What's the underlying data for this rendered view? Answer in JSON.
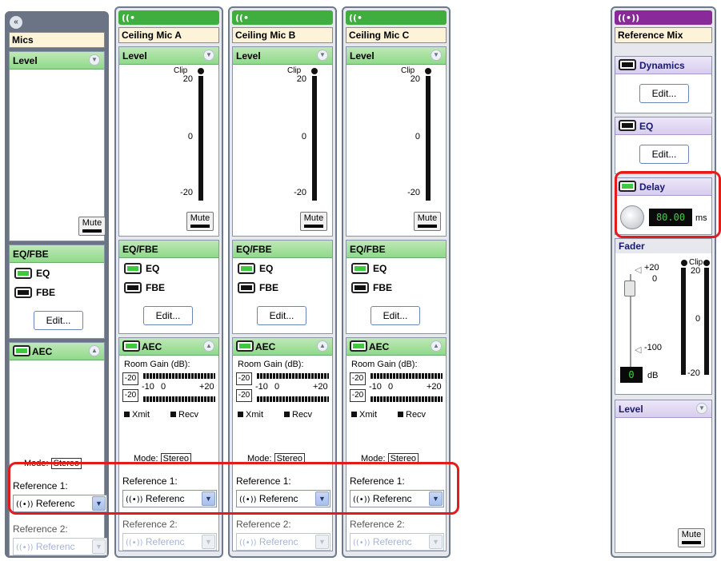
{
  "mics_strip": {
    "collapse_icon": "double-chevron-left-icon",
    "name": "Mics",
    "level_title": "Level",
    "mute_label": "Mute",
    "eqfbe_title": "EQ/FBE",
    "eq_label": "EQ",
    "fbe_label": "FBE",
    "edit_label": "Edit...",
    "aec_title": "AEC",
    "mode_label": "Mode:",
    "mode_value": "Stereo",
    "ref1_label": "Reference 1:",
    "ref1_value": "Referenc",
    "ref2_label": "Reference 2:",
    "ref2_value": "Referenc"
  },
  "channels": [
    {
      "name": "Ceiling Mic A",
      "level_title": "Level",
      "clip": "Clip",
      "tick_top": "20",
      "tick_mid": "0",
      "tick_bot": "-20",
      "mute_label": "Mute",
      "eqfbe_title": "EQ/FBE",
      "eq_label": "EQ",
      "fbe_label": "FBE",
      "edit_label": "Edit...",
      "aec_title": "AEC",
      "room_gain_label": "Room Gain (dB):",
      "gain_top": "-20",
      "gain_bot": "-20",
      "scale_left": "-10",
      "scale_mid": "0",
      "scale_right": "+20",
      "xmit": "Xmit",
      "recv": "Recv",
      "mode_label": "Mode:",
      "mode_value": "Stereo",
      "ref1_label": "Reference 1:",
      "ref1_value": "Referenc",
      "ref2_label": "Reference 2:",
      "ref2_value": "Referenc"
    },
    {
      "name": "Ceiling Mic B",
      "level_title": "Level",
      "clip": "Clip",
      "tick_top": "20",
      "tick_mid": "0",
      "tick_bot": "-20",
      "mute_label": "Mute",
      "eqfbe_title": "EQ/FBE",
      "eq_label": "EQ",
      "fbe_label": "FBE",
      "edit_label": "Edit...",
      "aec_title": "AEC",
      "room_gain_label": "Room Gain (dB):",
      "gain_top": "-20",
      "gain_bot": "-20",
      "scale_left": "-10",
      "scale_mid": "0",
      "scale_right": "+20",
      "xmit": "Xmit",
      "recv": "Recv",
      "mode_label": "Mode:",
      "mode_value": "Stereo",
      "ref1_label": "Reference 1:",
      "ref1_value": "Referenc",
      "ref2_label": "Reference 2:",
      "ref2_value": "Referenc"
    },
    {
      "name": "Ceiling Mic C",
      "level_title": "Level",
      "clip": "Clip",
      "tick_top": "20",
      "tick_mid": "0",
      "tick_bot": "-20",
      "mute_label": "Mute",
      "eqfbe_title": "EQ/FBE",
      "eq_label": "EQ",
      "fbe_label": "FBE",
      "edit_label": "Edit...",
      "aec_title": "AEC",
      "room_gain_label": "Room Gain (dB):",
      "gain_top": "-20",
      "gain_bot": "-20",
      "scale_left": "-10",
      "scale_mid": "0",
      "scale_right": "+20",
      "xmit": "Xmit",
      "recv": "Recv",
      "mode_label": "Mode:",
      "mode_value": "Stereo",
      "ref1_label": "Reference 1:",
      "ref1_value": "Referenc",
      "ref2_label": "Reference 2:",
      "ref2_value": "Referenc"
    }
  ],
  "ref_mix": {
    "name": "Reference Mix",
    "dynamics_title": "Dynamics",
    "eq_title": "EQ",
    "delay_title": "Delay",
    "edit_label": "Edit...",
    "delay_value": "80.00",
    "delay_unit": "ms",
    "fader_title": "Fader",
    "fader_top": "+20",
    "fader_zero": "0",
    "fader_bot": "-100",
    "clip": "Clip",
    "tick_top": "20",
    "tick_mid": "0",
    "tick_bot": "-20",
    "gain_value": "0",
    "gain_unit": "dB",
    "level_title": "Level",
    "mute_label": "Mute"
  },
  "colors": {
    "accent_green": "#3fae3f",
    "accent_purple": "#8a2a9a",
    "highlight_red": "#e41b1b",
    "led_green": "#3ec93e"
  }
}
